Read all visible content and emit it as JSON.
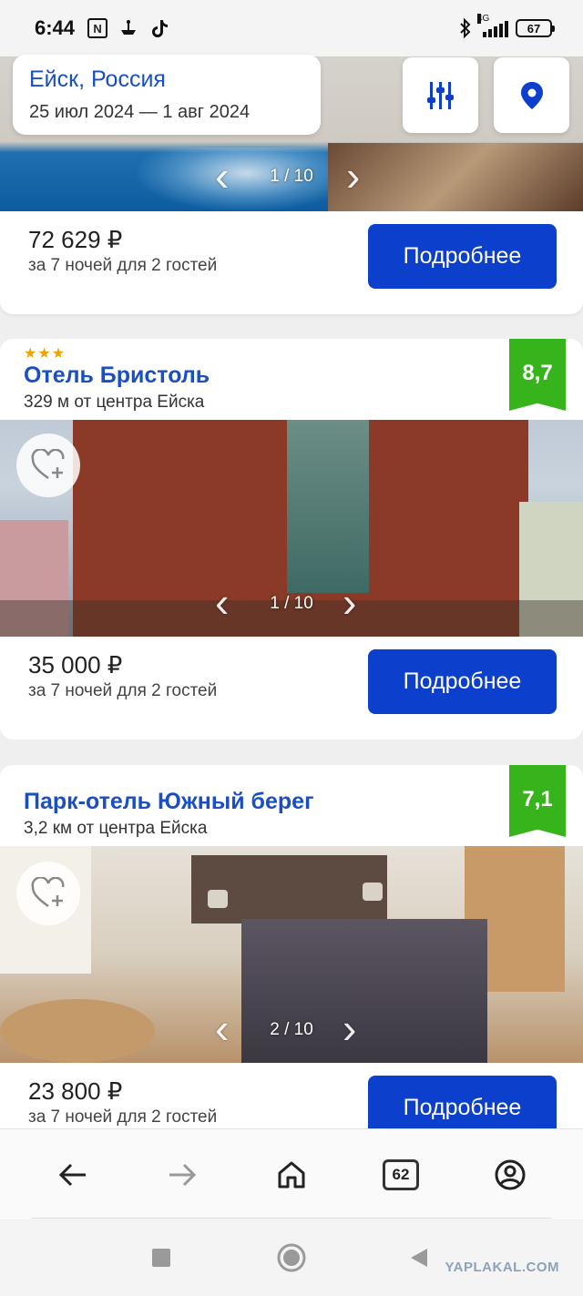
{
  "status_bar": {
    "time": "6:44",
    "network": "4G",
    "battery": "67"
  },
  "search": {
    "city": "Ейск, Россия",
    "dates": "25 июл 2024 — 1 авг 2024"
  },
  "top_card": {
    "image_counter": "1 / 10",
    "price": "72 629 ₽",
    "price_sub": "за 7 ночей для 2 гостей",
    "details_label": "Подробнее"
  },
  "hotels": [
    {
      "stars": "★★★",
      "name": "Отель Бристоль",
      "distance": "329 м от центра Ейска",
      "rating": "8,7",
      "image_counter": "1 / 10",
      "price": "35 000 ₽",
      "price_sub": "за 7 ночей для 2 гостей",
      "details_label": "Подробнее"
    },
    {
      "stars": "",
      "name": "Парк-отель Южный берег",
      "distance": "3,2 км от центра Ейска",
      "rating": "7,1",
      "image_counter": "2 / 10",
      "price": "23 800 ₽",
      "price_sub": "за 7 ночей для 2 гостей",
      "details_label": "Подробнее"
    }
  ],
  "browser_nav": {
    "tabs_count": "62"
  },
  "watermark": "YAPLAKAL.COM",
  "colors": {
    "accent": "#0b3fcc",
    "link": "#1a4fc4",
    "rating_bg": "#37b41c",
    "stars": "#f0a400"
  }
}
